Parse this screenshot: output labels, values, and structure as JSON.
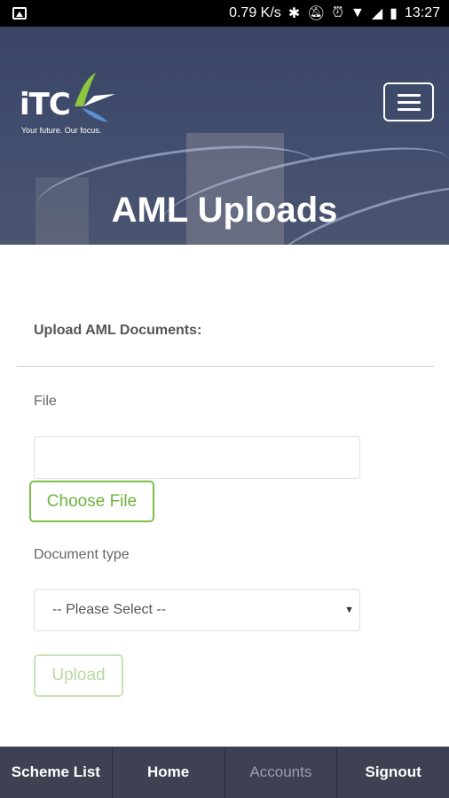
{
  "status_bar": {
    "speed": "0.79 K/s",
    "time": "13:27"
  },
  "header": {
    "logo_text": "iTC",
    "logo_tagline": "Your future. Our focus.",
    "page_title": "AML Uploads"
  },
  "form": {
    "section_title": "Upload AML Documents:",
    "file_label": "File",
    "file_value": "",
    "choose_file_label": "Choose File",
    "document_type_label": "Document type",
    "document_type_selected": "-- Please Select --",
    "upload_label": "Upload"
  },
  "bottom_nav": {
    "items": [
      {
        "label": "Scheme List"
      },
      {
        "label": "Home"
      },
      {
        "label": "Accounts"
      },
      {
        "label": "Signout"
      }
    ]
  },
  "colors": {
    "accent_green": "#6fb23c",
    "nav_bg": "#3d4151",
    "hero_bg": "#424e6e"
  }
}
